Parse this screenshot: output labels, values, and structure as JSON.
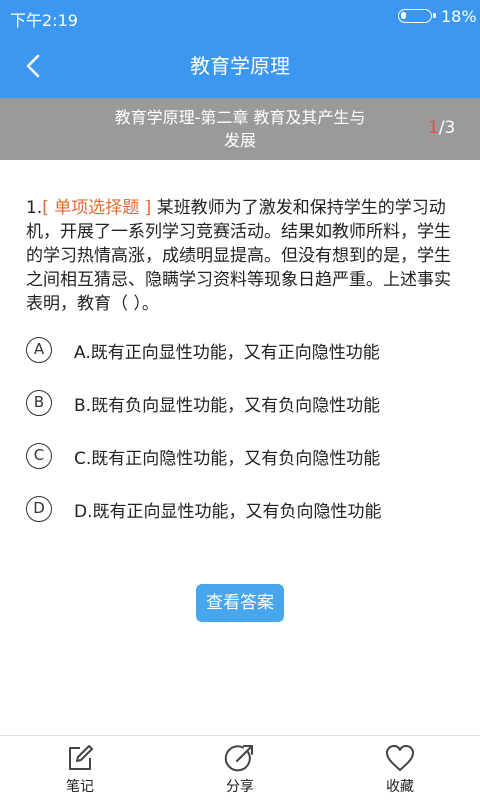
{
  "status_bar": {
    "time": "下午2:19",
    "battery_percent": "18%",
    "battery_level": 0.18
  },
  "header": {
    "title": "教育学原理"
  },
  "chapter": {
    "line1": "教育学原理-第二章 教育及其产生与",
    "line2": "发展",
    "current": "1",
    "total": "/3"
  },
  "question": {
    "number": "1.",
    "type": "[ 单项选择题 ]",
    "text": "某班教师为了激发和保持学生的学习动机，开展了一系列学习竞赛活动。结果如教师所料，学生的学习热情高涨，成绩明显提高。但没有想到的是，学生之间相互猜忌、隐瞒学习资料等现象日趋严重。上述事实表明，教育（ ）。",
    "options": [
      {
        "letter": "A",
        "text": "A.既有正向显性功能，又有正向隐性功能"
      },
      {
        "letter": "B",
        "text": "B.既有负向显性功能，又有负向隐性功能"
      },
      {
        "letter": "C",
        "text": "C.既有正向隐性功能，又有负向隐性功能"
      },
      {
        "letter": "D",
        "text": "D.既有正向显性功能，又有负向隐性功能"
      }
    ]
  },
  "answer_button": {
    "label": "查看答案"
  },
  "footer": {
    "notes": {
      "label": "笔记",
      "icon": "edit-icon"
    },
    "share": {
      "label": "分享",
      "icon": "share-icon"
    },
    "favorite": {
      "label": "收藏",
      "icon": "heart-icon"
    }
  },
  "colors": {
    "header": "#3c97f0",
    "chapter_bar": "#9a9a9a",
    "accent_orange": "#e8692e",
    "counter_red": "#e04b4b",
    "button": "#48a6ee"
  }
}
